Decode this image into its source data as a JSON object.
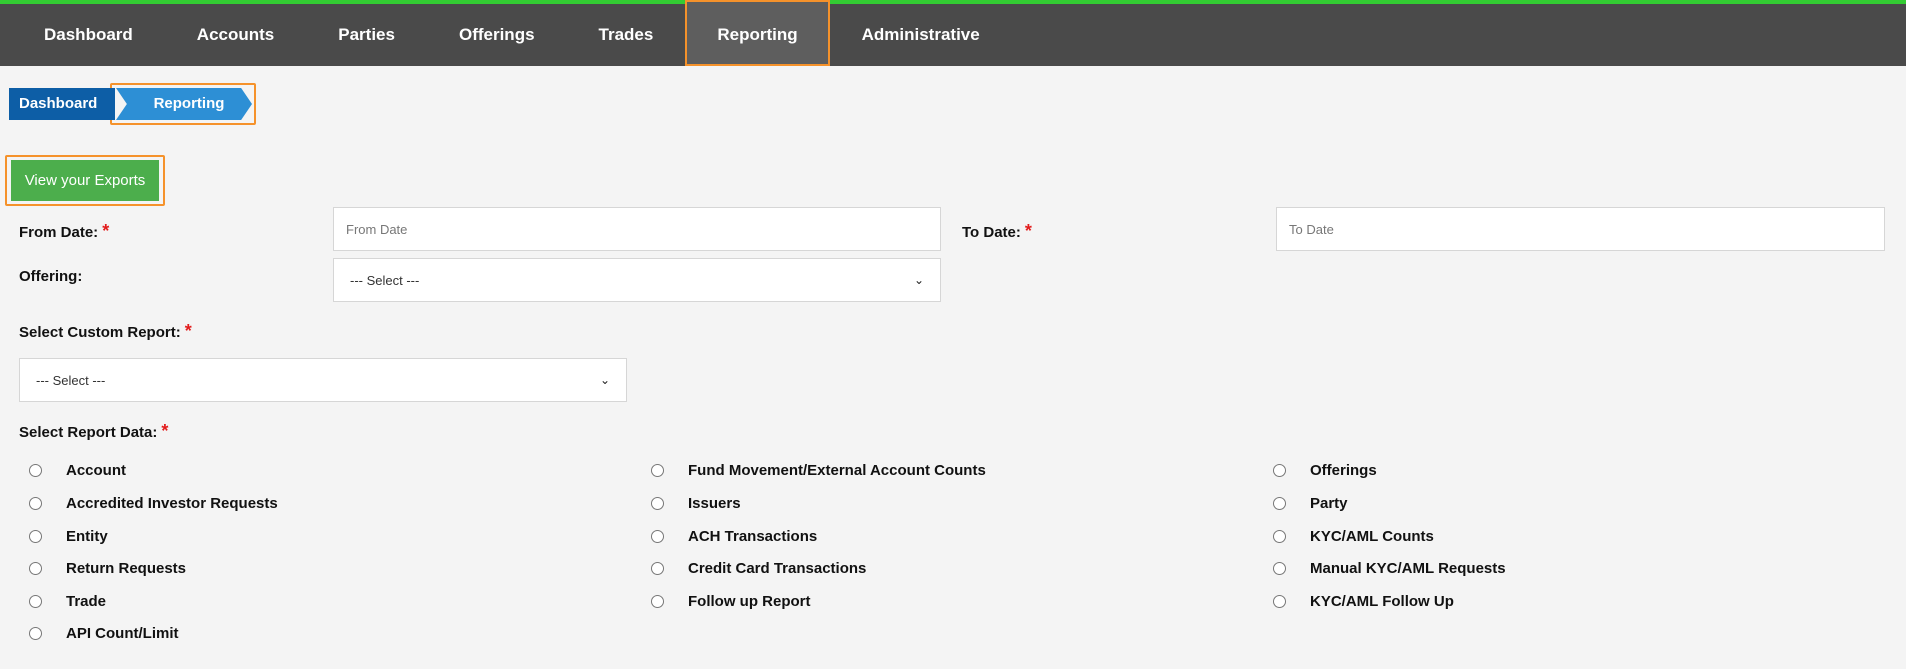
{
  "nav": {
    "items": [
      {
        "label": "Dashboard"
      },
      {
        "label": "Accounts"
      },
      {
        "label": "Parties"
      },
      {
        "label": "Offerings"
      },
      {
        "label": "Trades"
      },
      {
        "label": "Reporting",
        "active": true
      },
      {
        "label": "Administrative"
      }
    ]
  },
  "breadcrumb": {
    "home": "Dashboard",
    "current": "Reporting"
  },
  "exports_button": "View your Exports",
  "form": {
    "from_date": {
      "label": "From Date:",
      "placeholder": "From Date"
    },
    "to_date": {
      "label": "To Date:",
      "placeholder": "To Date"
    },
    "offering": {
      "label": "Offering:",
      "selected": "--- Select ---"
    },
    "custom_report": {
      "label": "Select Custom Report:",
      "selected": "--- Select ---"
    },
    "report_data": {
      "label": "Select Report Data:"
    },
    "required_mark": "*"
  },
  "report_options": {
    "col1": [
      "Account",
      "Accredited Investor Requests",
      "Entity",
      "Return Requests",
      "Trade",
      "API Count/Limit"
    ],
    "col2": [
      "Fund Movement/External Account Counts",
      "Issuers",
      "ACH Transactions",
      "Credit Card Transactions",
      "Follow up Report"
    ],
    "col3": [
      "Offerings",
      "Party",
      "KYC/AML Counts",
      "Manual KYC/AML Requests",
      "KYC/AML Follow Up"
    ]
  },
  "colors": {
    "nav_bg": "#4a4a4a",
    "nav_top_accent": "#33cc33",
    "highlight": "#f5922b",
    "breadcrumb_home": "#0d5ea6",
    "breadcrumb_current": "#2d8fd5",
    "exports_button": "#4cae4c",
    "required": "#e21b1b"
  }
}
